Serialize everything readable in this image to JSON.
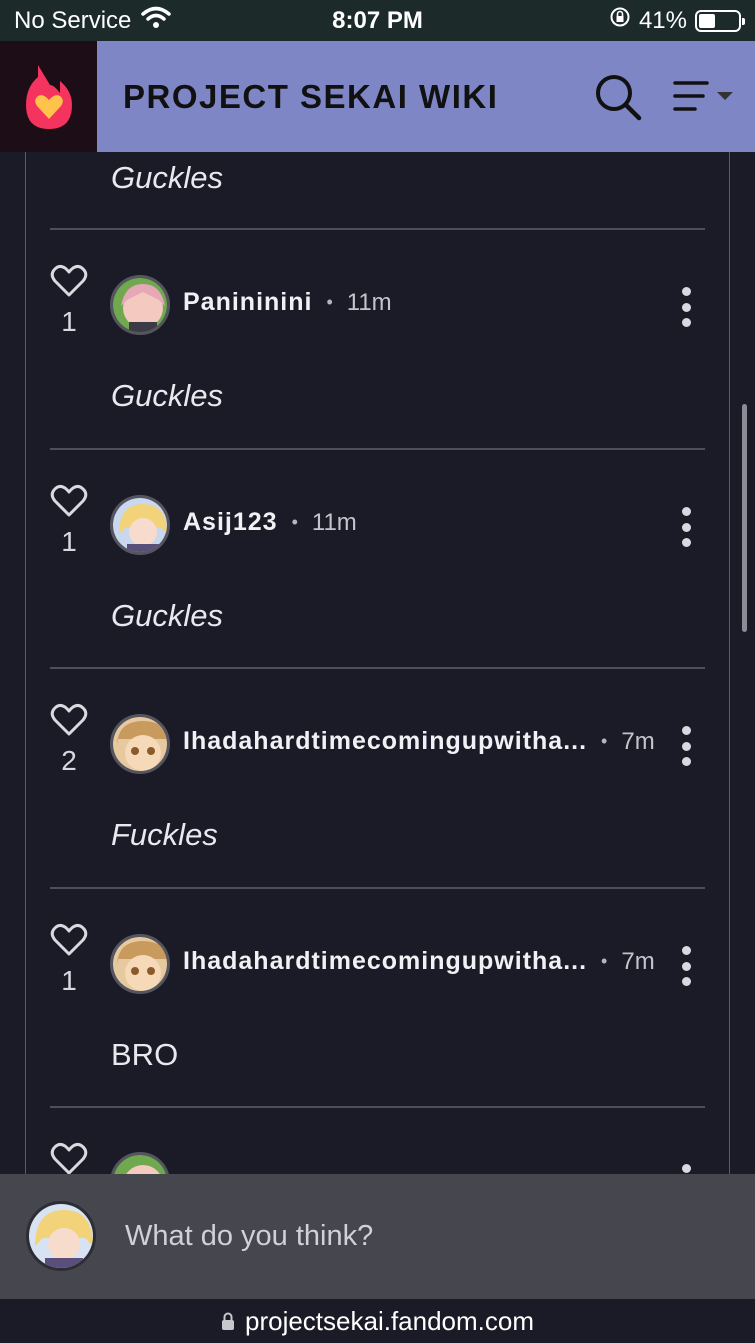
{
  "status_bar": {
    "carrier": "No Service",
    "time": "8:07 PM",
    "battery": "41%",
    "battery_level": 0.41
  },
  "header": {
    "title": "PROJECT SEKAI WIKI",
    "logo_icon": "fandom-flame-heart-icon",
    "search_icon": "search-icon",
    "menu_icon": "menu-dropdown-icon"
  },
  "thread": {
    "top_partial_text": "Guckles",
    "comments": [
      {
        "likes": "1",
        "username": "Panininini",
        "time": "11m",
        "text": "Guckles",
        "italic": true,
        "avatar": "avatar-panininini"
      },
      {
        "likes": "1",
        "username": "Asij123",
        "time": "11m",
        "text": "Guckles",
        "italic": true,
        "avatar": "avatar-asij123"
      },
      {
        "likes": "2",
        "username": "Ihadahardtimecomingupwitha...",
        "time": "7m",
        "text": "Fuckles",
        "italic": true,
        "avatar": "avatar-ihadahardtime"
      },
      {
        "likes": "1",
        "username": "Ihadahardtimecomingupwitha...",
        "time": "7m",
        "text": "BRO",
        "italic": false,
        "avatar": "avatar-ihadahardtime"
      }
    ]
  },
  "reply": {
    "placeholder": "What do you think?"
  },
  "browser": {
    "url": "projectsekai.fandom.com"
  },
  "colors": {
    "header_bg": "#7e86c6",
    "page_bg": "#1b1b27",
    "reply_bg": "#46474e",
    "logo_bg": "#1c0d16",
    "flame": "#f4335e",
    "heart": "#ffc24a"
  }
}
